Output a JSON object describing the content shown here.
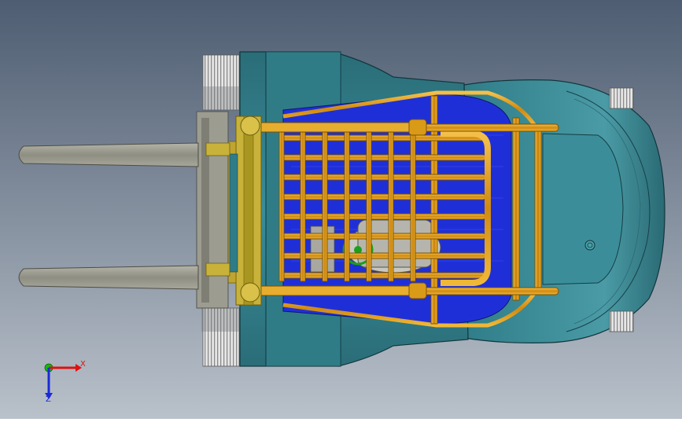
{
  "viewport": {
    "background_top": "#4e5d72",
    "background_bottom": "#b9c1ca"
  },
  "model": {
    "body_color": "#2f7a86",
    "body_dark": "#1d5560",
    "guard_color": "#e8a21a",
    "floor_color": "#1f2fd8",
    "fork_color": "#9a9a8e",
    "tire_color": "#d8d8d8",
    "mast_color": "#c9b23a"
  },
  "triad": {
    "x_label": "X",
    "z_label": "Z",
    "x_color": "#e01010",
    "y_color": "#14b814",
    "z_color": "#1a2ad8"
  }
}
